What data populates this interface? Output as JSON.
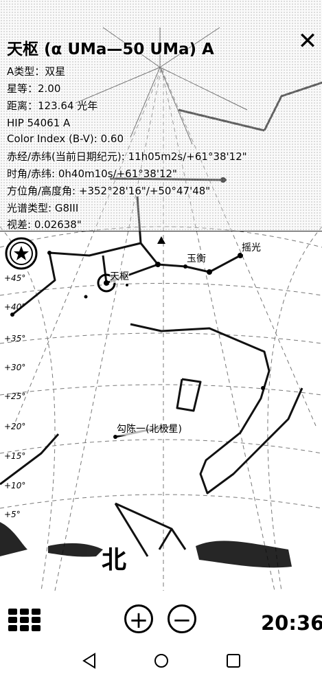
{
  "header": {
    "title": "天枢 (α UMa—50 UMa) A",
    "close_icon": "close-icon",
    "info_lines": [
      "A类型：双星",
      "星等：2.00",
      "距离：123.64 光年",
      "HIP 54061 A",
      "Color Index (B-V): 0.60",
      "赤经/赤纬(当前日期纪元): 11h05m2s/+61°38'12\"",
      "时角/赤纬: 0h40m10s/+61°38'12\"",
      "方位角/高度角: +352°28'16\"/+50°47'48\"",
      "光谱类型: G8III",
      "视差: 0.02638\""
    ]
  },
  "sky": {
    "star_labels": [
      "玉衡",
      "摇光",
      "天枢",
      "勾陈一(北极星)"
    ],
    "grid_labels": [
      "+45°",
      "+40°",
      "+35°",
      "+30°",
      "+25°",
      "+20°",
      "+15°",
      "+10°",
      "+5°"
    ],
    "compass": "北",
    "selected_marker": "star-target-icon"
  },
  "bottom_bar": {
    "menu_icon": "grid-menu-icon",
    "zoom_in": "+",
    "zoom_out": "−",
    "clock": "20:36"
  },
  "navbar": {
    "back": "back-icon",
    "home": "home-icon",
    "recents": "recents-icon"
  }
}
